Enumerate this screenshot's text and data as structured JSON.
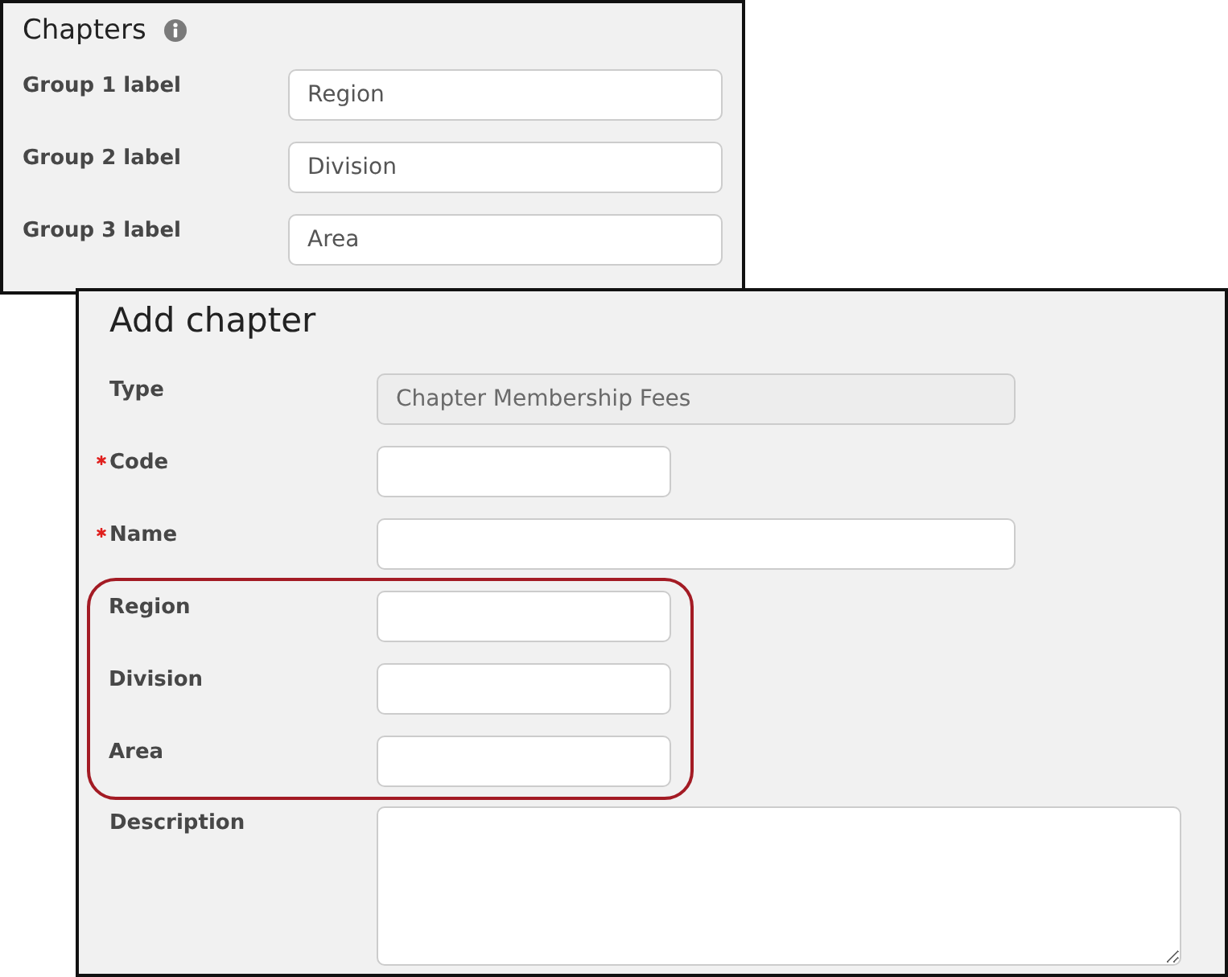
{
  "chapters_settings": {
    "title": "Chapters",
    "fields": [
      {
        "label": "Group 1 label",
        "value": "Region"
      },
      {
        "label": "Group 2 label",
        "value": "Division"
      },
      {
        "label": "Group 3 label",
        "value": "Area"
      }
    ]
  },
  "add_chapter": {
    "title": "Add chapter",
    "fields": [
      {
        "label": "Type",
        "kind": "wide",
        "value": "Chapter Membership Fees",
        "disabled": true,
        "required": false,
        "highlighted": false
      },
      {
        "label": "Code",
        "kind": "short",
        "disabled": false,
        "required": true,
        "highlighted": false
      },
      {
        "label": "Name",
        "kind": "wide",
        "disabled": false,
        "required": true,
        "highlighted": false
      },
      {
        "label": "Region",
        "kind": "short",
        "disabled": false,
        "required": false,
        "highlighted": true
      },
      {
        "label": "Division",
        "kind": "short",
        "disabled": false,
        "required": false,
        "highlighted": true
      },
      {
        "label": "Area",
        "kind": "short",
        "disabled": false,
        "required": false,
        "highlighted": true
      },
      {
        "label": "Description",
        "kind": "multiline",
        "disabled": false,
        "required": false,
        "highlighted": false
      }
    ]
  }
}
